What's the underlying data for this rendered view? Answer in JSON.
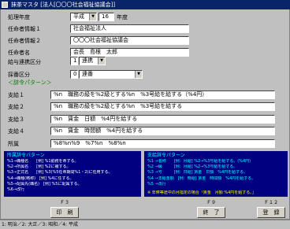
{
  "window": {
    "title": "抹茶マスタ [法人[〇〇〇社会福祉協議会]]"
  },
  "form": {
    "fiscal_year": {
      "label": "処理年度",
      "era": "平成",
      "year": "16",
      "suffix": "年度"
    },
    "appointer_info_1": {
      "label": "任命者情報１",
      "value": "社会福祉法人"
    },
    "appointer_info_2": {
      "label": "任命者情報２",
      "value": "〇〇〇社会福祉協議会"
    },
    "appointer_name": {
      "label": "任命者名",
      "value": "会長　島根　太郎"
    },
    "salary_order_type": {
      "label": "給与連携区分",
      "code": "1",
      "name": "連携"
    },
    "hiring_type": {
      "label": "採番区分",
      "code": "0",
      "name": "連番"
    }
  },
  "phrase_section": {
    "title": "＜辞令パターン＞",
    "rows": [
      {
        "label": "支給１",
        "value": "%n　職務の級を%2級とする%n　%3号給を給する（%4円）"
      },
      {
        "label": "支給２",
        "value": "%n　職務の級を%2級とする%n　%3号給を給する"
      },
      {
        "label": "支給３",
        "value": "%n　賃金　日額　%4円を給する"
      },
      {
        "label": "支給４",
        "value": "%n　賃金　時間額　%4円を給する"
      },
      {
        "label": "所属",
        "value": "%8%n%9　%7%n　%8%n"
      }
    ]
  },
  "left_panel": {
    "title": "所属辞令パターン",
    "lines": [
      "%1→職種名　　[例] %1勤務を命ずる。",
      "%2→所属名　　[例] %2に補する。",
      "%3→正式名　　[例] %3(%5任命期間%1・2)に任用する。",
      "%4→職種(略称)　[例] %4に任する。",
      "%5→配属先(職名)　[例] %5に配属する。",
      "%6→改行"
    ]
  },
  "right_panel": {
    "title": "支給辞令パターン",
    "lines": [
      "%1 →名称　　[例：月給] %2→%3号給を給する。(%4円)",
      "%2 →級　　　[例：月給] %2→%3号給を給する。",
      "%3 →号　　　[例：日給] 賃金　日額　%4円を給する。",
      "%4 →支給金額　[例：時給] 賃金　時間額　%4円を給する。",
      "%5 →改行"
    ],
    "note": "※ 年俸等途中の月指定の場合「賃金　月額 %4円を給する。」"
  },
  "function_keys": [
    {
      "key": "Ｆ３",
      "label": "印　刷"
    },
    {
      "key": "Ｆ９",
      "label": "終　了"
    },
    {
      "key": "Ｆ１２",
      "label": "登　録"
    }
  ],
  "status_bar": {
    "text": "1: 明治／2: 大正／3: 昭和／4: 平成"
  }
}
